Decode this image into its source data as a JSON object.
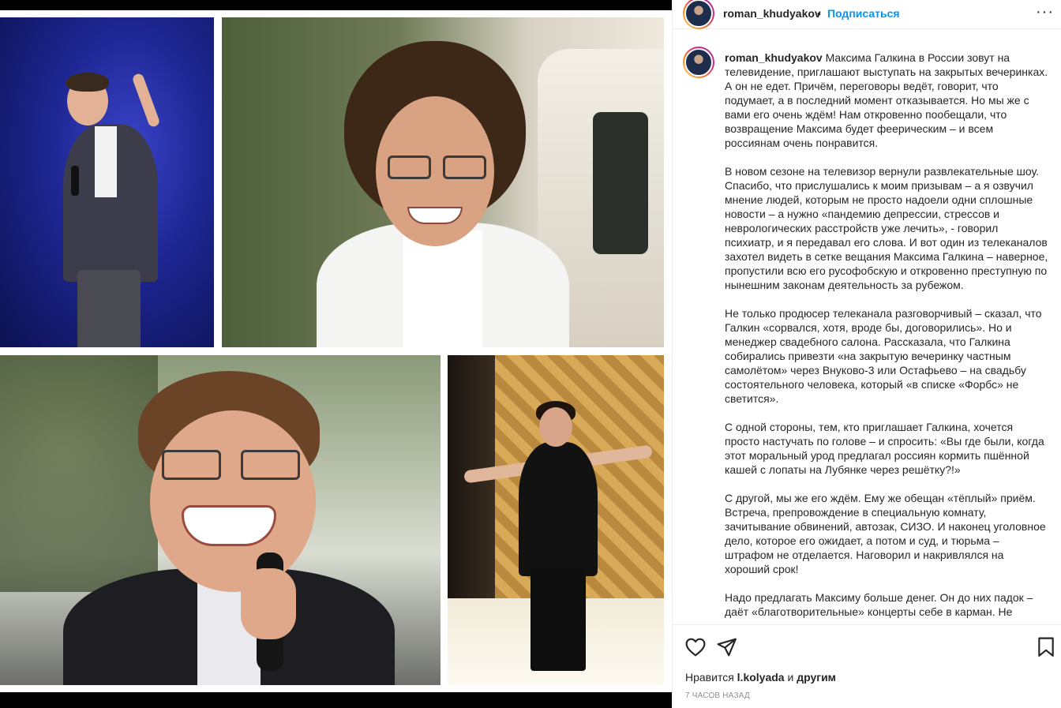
{
  "post": {
    "author": "roman_khudyakov",
    "separator": "•",
    "follow_label": "Подписаться",
    "more_label": "···"
  },
  "caption": {
    "author": "roman_khudyakov",
    "paragraphs": [
      "Максима Галкина в России зовут на телевидение, приглашают выступать на закрытых вечеринках. А он не едет. Причём, переговоры ведёт, говорит, что подумает, а в последний момент отказывается. Но мы же с вами его очень ждём! Нам откровенно пообещали, что возвращение Максима будет феерическим – и всем россиянам очень понравится.",
      "В новом сезоне на телевизор вернули развлекательные шоу. Спасибо, что прислушались к моим призывам – а я озвучил мнение людей, которым не просто надоели одни сплошные новости – а нужно «пандемию депрессии, стрессов и неврологических расстройств уже лечить», - говорил психиатр, и я передавал его слова. И вот один из телеканалов захотел видеть в сетке вещания Максима Галкина – наверное, пропустили всю его русофобскую и откровенно преступную по нынешним законам деятельность за рубежом.",
      "Не только продюсер телеканала разговорчивый – сказал, что Галкин «сорвался, хотя, вроде бы, договорились». Но и менеджер свадебного салона. Рассказала, что Галкина собирались привезти «на закрытую вечеринку частным самолётом» через Внуково-3 или Остафьево – на свадьбу состоятельного человека, который «в списке «Форбс» не светится».",
      "С одной стороны, тем, кто приглашает Галкина, хочется просто настучать по голове – и спросить: «Вы где были, когда этот моральный урод предлагал россиян кормить пшённой кашей с лопаты на Лубянке через решётку?!»",
      "С другой, мы же его ждём. Ему же обещан «тёплый» приём. Встреча, препровождение в специальную комнату, зачитывание обвинений, автозак, СИЗО. И наконец уголовное дело, которое его ожидает, а потом и суд, и тюрьма – штрафом не отделается. Наговорил и накривлялся на хороший срок!",
      "Надо предлагать Максиму больше денег. Он до них падок – даёт «благотворительные» концерты себе в карман. Не просто"
    ]
  },
  "footer": {
    "likes_prefix": "Нравится",
    "likes_user": "l.kolyada",
    "likes_conj": "и",
    "likes_others": "другим",
    "time": "7 ЧАСОВ НАЗАД"
  },
  "icons": {
    "like": "heart-icon",
    "share": "paper-plane-icon",
    "save": "bookmark-icon",
    "more": "more-options-icon"
  },
  "colors": {
    "accent": "#0095f6",
    "text": "#262626",
    "muted": "#8e8e8e"
  }
}
